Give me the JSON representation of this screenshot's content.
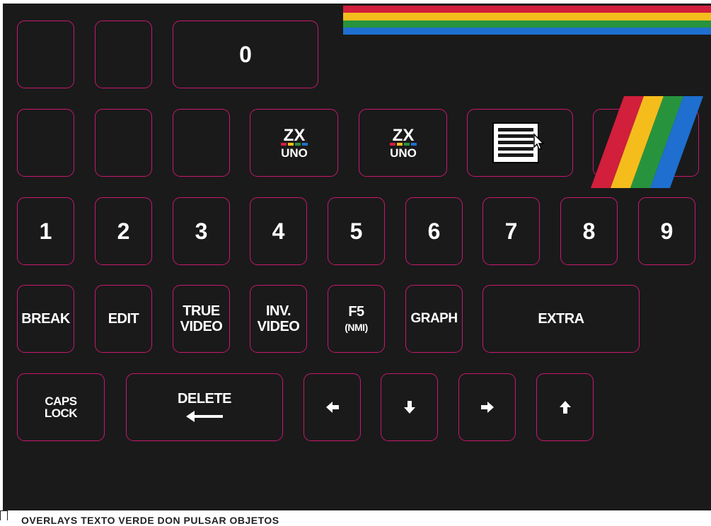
{
  "colors": {
    "background": "#1a1a1a",
    "key_border": "#c8186e",
    "stripe_red": "#d11f3c",
    "stripe_yellow": "#f5bd1c",
    "stripe_green": "#27943d",
    "stripe_blue": "#1e6fd0"
  },
  "row0": {
    "zero": "0"
  },
  "row1": {
    "zxuno_icon_1": "zxuno-logo-icon",
    "zxuno_icon_2": "zxuno-logo-icon",
    "menu_icon": "menu-window-cursor-icon",
    "spectrum_icon": "spectrum-stripes-icon"
  },
  "digits": [
    "1",
    "2",
    "3",
    "4",
    "5",
    "6",
    "7",
    "8",
    "9"
  ],
  "row3": {
    "break": "BREAK",
    "edit": "EDIT",
    "true_video_1": "TRUE",
    "true_video_2": "VIDEO",
    "inv_video_1": "INV.",
    "inv_video_2": "VIDEO",
    "f5": "F5",
    "nmi": "(NMI)",
    "graph": "GRAPH",
    "extra": "EXTRA"
  },
  "row4": {
    "caps_1": "CAPS",
    "caps_2": "LOCK",
    "delete": "DELETE",
    "left_icon": "arrow-left-icon",
    "down_icon": "arrow-down-icon",
    "right_icon": "arrow-right-icon",
    "up_icon": "arrow-up-icon"
  },
  "footer": {
    "clipped_text": "OVERLAYS TEXTO VERDE DON PULSAR OBJETOS"
  }
}
